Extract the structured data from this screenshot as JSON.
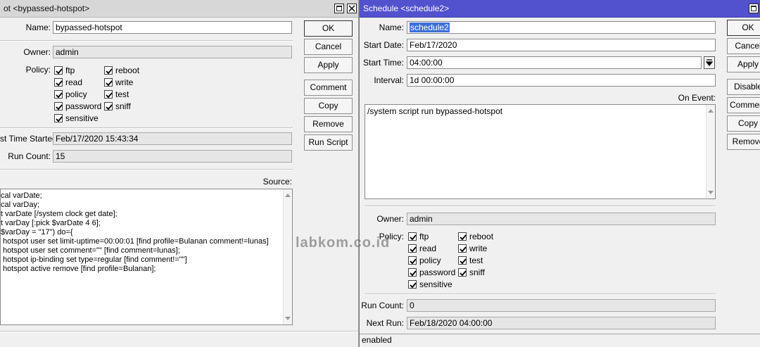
{
  "left_window": {
    "title": "ot <bypassed-hotspot>",
    "name_label": "Name:",
    "name_value": "bypassed-hotspot",
    "owner_label": "Owner:",
    "owner_value": "admin",
    "policy_label": "Policy:",
    "policies": [
      {
        "label": "ftp",
        "checked": true
      },
      {
        "label": "reboot",
        "checked": true
      },
      {
        "label": "read",
        "checked": true
      },
      {
        "label": "write",
        "checked": true
      },
      {
        "label": "policy",
        "checked": true
      },
      {
        "label": "test",
        "checked": true
      },
      {
        "label": "password",
        "checked": true
      },
      {
        "label": "sniff",
        "checked": true
      },
      {
        "label": "sensitive",
        "checked": true
      }
    ],
    "last_started_label": "st Time Started:",
    "last_started_value": "Feb/17/2020 15:43:34",
    "run_count_label": "Run Count:",
    "run_count_value": "15",
    "source_label": "Source:",
    "source_lines": [
      "cal varDate;",
      "cal varDay;",
      "t varDate [/system clock get date];",
      "t varDay [:pick $varDate 4 6];",
      "$varDay = \"17\") do={",
      " hotspot user set limit-uptime=00:00:01 [find profile=Bulanan comment!=lunas]",
      " hotspot user set comment=\"\" [find comment=lunas];",
      " hotspot ip-binding set type=regular [find comment!=\"\"]",
      " hotspot active remove [find profile=Bulanan];"
    ],
    "buttons": {
      "ok": "OK",
      "cancel": "Cancel",
      "apply": "Apply",
      "comment": "Comment",
      "copy": "Copy",
      "remove": "Remove",
      "run_script": "Run Script"
    }
  },
  "right_window": {
    "title": "Schedule <schedule2>",
    "name_label": "Name:",
    "name_value": "schedule2",
    "start_date_label": "Start Date:",
    "start_date_value": "Feb/17/2020",
    "start_time_label": "Start Time:",
    "start_time_value": "04:00:00",
    "interval_label": "Interval:",
    "interval_value": "1d 00:00:00",
    "on_event_label": "On Event:",
    "on_event_value": "/system script run bypassed-hotspot",
    "owner_label": "Owner:",
    "owner_value": "admin",
    "policy_label": "Policy:",
    "policies": [
      {
        "label": "ftp",
        "checked": true
      },
      {
        "label": "reboot",
        "checked": true
      },
      {
        "label": "read",
        "checked": true
      },
      {
        "label": "write",
        "checked": true
      },
      {
        "label": "policy",
        "checked": true
      },
      {
        "label": "test",
        "checked": true
      },
      {
        "label": "password",
        "checked": true
      },
      {
        "label": "sniff",
        "checked": true
      },
      {
        "label": "sensitive",
        "checked": true
      }
    ],
    "run_count_label": "Run Count:",
    "run_count_value": "0",
    "next_run_label": "Next Run:",
    "next_run_value": "Feb/18/2020 04:00:00",
    "status": "enabled",
    "buttons": {
      "ok": "OK",
      "cancel": "Cancel",
      "apply": "Apply",
      "disable": "Disable",
      "comment": "Comment",
      "copy": "Copy",
      "remove": "Remove"
    }
  },
  "watermark": "labkom.co.id",
  "colors": {
    "active_titlebar": "#5251ce",
    "inactive_titlebar": "#d7d7d7",
    "selection": "#3d6fd6",
    "window_bg": "#f0f0f0"
  }
}
